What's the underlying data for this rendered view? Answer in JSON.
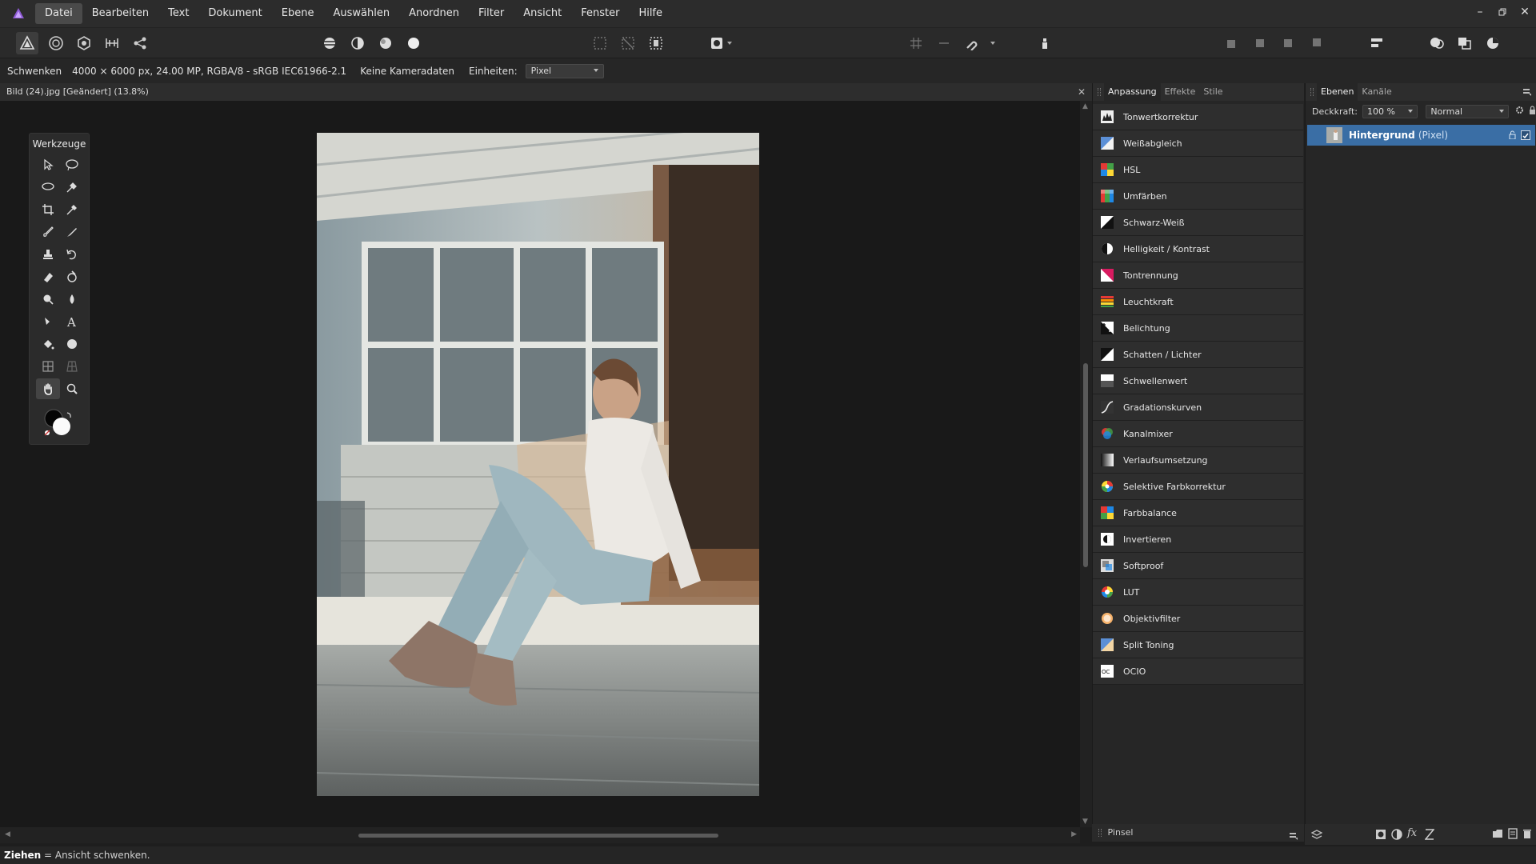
{
  "menu": [
    "Datei",
    "Bearbeiten",
    "Text",
    "Dokument",
    "Ebene",
    "Auswählen",
    "Anordnen",
    "Filter",
    "Ansicht",
    "Fenster",
    "Hilfe"
  ],
  "context": {
    "tool": "Schwenken",
    "info": "4000 × 6000 px, 24.00 MP, RGBA/8 - sRGB IEC61966-2.1",
    "camera": "Keine Kameradaten",
    "units_label": "Einheiten:",
    "units_value": "Pixel"
  },
  "document": {
    "title": "Bild (24).jpg [Geändert] (13.8%)",
    "close": "✕"
  },
  "tools": {
    "title": "Werkzeuge"
  },
  "adjust": {
    "tabs": [
      "Anpassung",
      "Effekte",
      "Stile"
    ],
    "items": [
      {
        "label": "Tonwertkorrektur",
        "icon": "levels-icon"
      },
      {
        "label": "Weißabgleich",
        "icon": "white-balance-icon"
      },
      {
        "label": "HSL",
        "icon": "hsl-icon"
      },
      {
        "label": "Umfärben",
        "icon": "recolor-icon"
      },
      {
        "label": "Schwarz-Weiß",
        "icon": "black-white-icon"
      },
      {
        "label": "Helligkeit / Kontrast",
        "icon": "brightness-contrast-icon"
      },
      {
        "label": "Tontrennung",
        "icon": "posterize-icon"
      },
      {
        "label": "Leuchtkraft",
        "icon": "vibrance-icon"
      },
      {
        "label": "Belichtung",
        "icon": "exposure-icon"
      },
      {
        "label": "Schatten / Lichter",
        "icon": "shadows-highlights-icon"
      },
      {
        "label": "Schwellenwert",
        "icon": "threshold-icon"
      },
      {
        "label": "Gradationskurven",
        "icon": "curves-icon"
      },
      {
        "label": "Kanalmixer",
        "icon": "channel-mixer-icon"
      },
      {
        "label": "Verlaufsumsetzung",
        "icon": "gradient-map-icon"
      },
      {
        "label": "Selektive Farbkorrektur",
        "icon": "selective-color-icon"
      },
      {
        "label": "Farbbalance",
        "icon": "color-balance-icon"
      },
      {
        "label": "Invertieren",
        "icon": "invert-icon"
      },
      {
        "label": "Softproof",
        "icon": "soft-proof-icon"
      },
      {
        "label": "LUT",
        "icon": "lut-icon"
      },
      {
        "label": "Objektivfilter",
        "icon": "lens-filter-icon"
      },
      {
        "label": "Split Toning",
        "icon": "split-toning-icon"
      },
      {
        "label": "OCIO",
        "icon": "ocio-icon"
      }
    ]
  },
  "layers": {
    "tabs": [
      "Ebenen",
      "Kanäle"
    ],
    "opacity_label": "Deckkraft:",
    "opacity_value": "100 %",
    "blend_mode": "Normal",
    "layer_name": "Hintergrund",
    "layer_kind": "(Pixel)"
  },
  "brush_panel": "Pinsel",
  "status": {
    "key": "Ziehen",
    "text": " = Ansicht schwenken."
  },
  "colors": {
    "accent": "#3a6ea5",
    "app_purple": "#8f5bd6"
  }
}
